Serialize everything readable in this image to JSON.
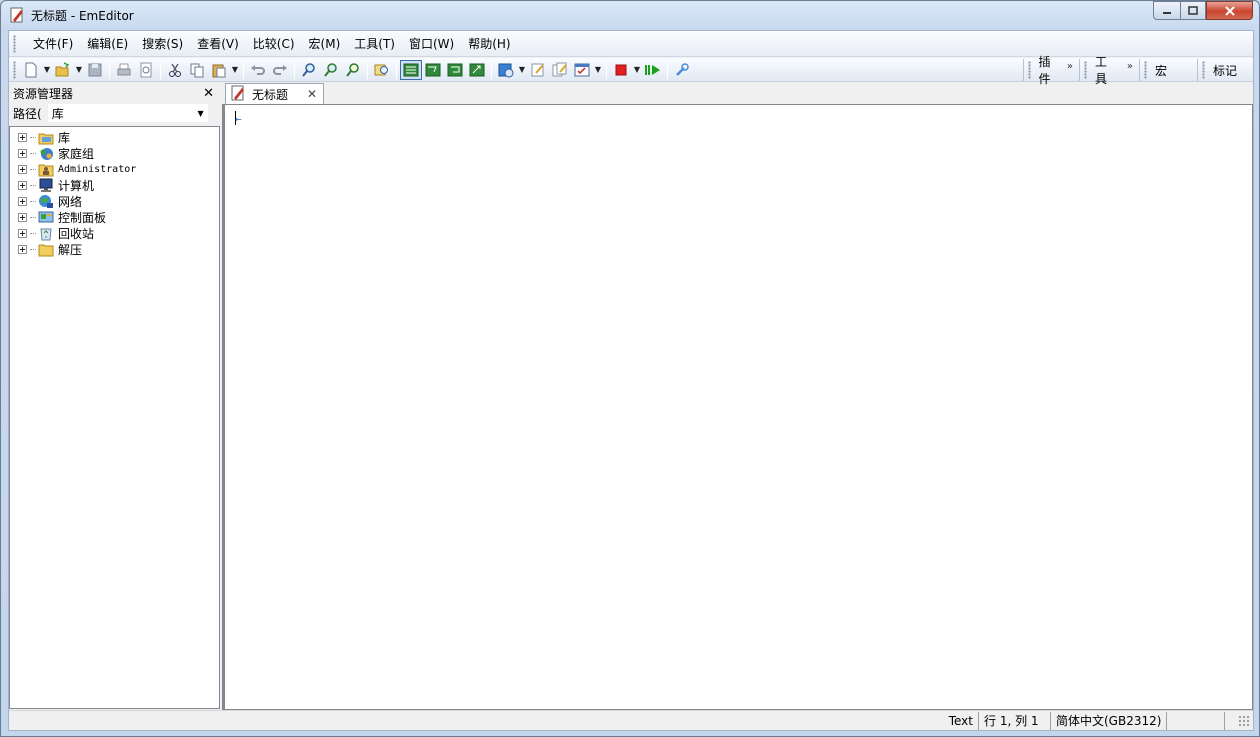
{
  "window": {
    "title": "无标题 - EmEditor"
  },
  "menubar": {
    "items": [
      "文件(F)",
      "编辑(E)",
      "搜索(S)",
      "查看(V)",
      "比较(C)",
      "宏(M)",
      "工具(T)",
      "窗口(W)",
      "帮助(H)"
    ]
  },
  "toolbar": {
    "panels": {
      "plugins": "插件",
      "tools": "工具",
      "macros": "宏",
      "markers": "标记"
    },
    "chevron": "»"
  },
  "explorer": {
    "title": "资源管理器",
    "path_label": "路径(",
    "path_value": "库",
    "tree": [
      {
        "label": "库",
        "icon": "library-icon"
      },
      {
        "label": "家庭组",
        "icon": "homegroup-icon"
      },
      {
        "label": "Administrator",
        "icon": "user-folder-icon"
      },
      {
        "label": "计算机",
        "icon": "computer-icon"
      },
      {
        "label": "网络",
        "icon": "network-icon"
      },
      {
        "label": "控制面板",
        "icon": "control-panel-icon"
      },
      {
        "label": "回收站",
        "icon": "recycle-bin-icon"
      },
      {
        "label": "解压",
        "icon": "folder-icon"
      }
    ]
  },
  "editor": {
    "tab_label": "无标题"
  },
  "statusbar": {
    "mode": "Text",
    "position": "行 1, 列 1",
    "encoding": "简体中文(GB2312)"
  },
  "colors": {
    "accent": "#3b6ea5",
    "close": "#c9452f",
    "stop": "#e02020",
    "play": "#18a018"
  }
}
